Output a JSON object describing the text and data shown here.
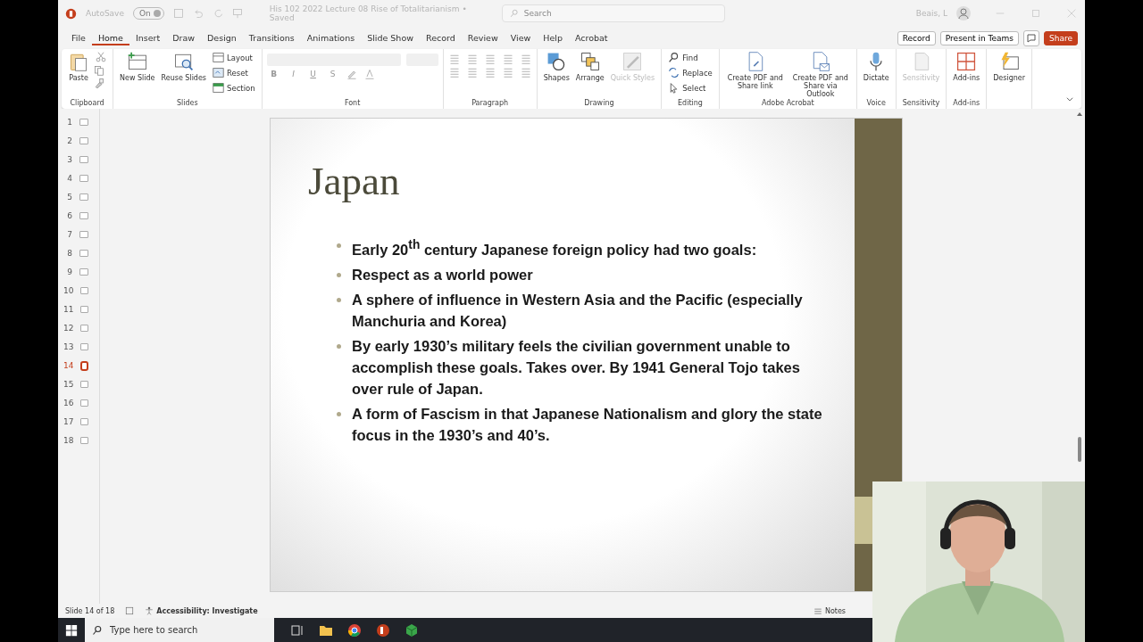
{
  "title_bar": {
    "autosave": {
      "label": "AutoSave",
      "on": true,
      "state_text": "On"
    },
    "document_title": "His 102 2022 Lecture 08 Rise of Totalitarianism • Saved",
    "search": {
      "placeholder": "Search"
    },
    "user": "Beais, L"
  },
  "menu": [
    {
      "label": "File",
      "selected": false
    },
    {
      "label": "Home",
      "selected": true
    },
    {
      "label": "Insert",
      "selected": false
    },
    {
      "label": "Draw",
      "selected": false
    },
    {
      "label": "Design",
      "selected": false
    },
    {
      "label": "Transitions",
      "selected": false
    },
    {
      "label": "Animations",
      "selected": false
    },
    {
      "label": "Slide Show",
      "selected": false
    },
    {
      "label": "Record",
      "selected": false
    },
    {
      "label": "Review",
      "selected": false
    },
    {
      "label": "View",
      "selected": false
    },
    {
      "label": "Help",
      "selected": false
    },
    {
      "label": "Acrobat",
      "selected": false
    }
  ],
  "actions": [
    {
      "label": "Record",
      "kind": "outline"
    },
    {
      "label": "Present in Teams",
      "kind": "outline"
    },
    {
      "label": "Share",
      "kind": "primary"
    }
  ],
  "ribbon": {
    "groups": [
      {
        "name": "Clipboard",
        "kind": "buttons",
        "items": [
          {
            "label": "Paste",
            "kind": "large",
            "disabled": false
          }
        ]
      },
      {
        "name": "Slides",
        "kind": "buttons",
        "items": [
          {
            "label": "New Slide",
            "kind": "large",
            "disabled": false
          },
          {
            "label": "Reuse Slides",
            "kind": "large",
            "disabled": false
          },
          {
            "label": "Layout",
            "kind": "small",
            "disabled": false
          },
          {
            "label": "Reset",
            "kind": "small",
            "disabled": false
          },
          {
            "label": "Section",
            "kind": "small",
            "disabled": false
          }
        ]
      },
      {
        "name": "Font",
        "kind": "font",
        "format_buttons": [
          "B",
          "I",
          "U",
          "S"
        ]
      },
      {
        "name": "Paragraph",
        "kind": "paragraph"
      },
      {
        "name": "Drawing",
        "kind": "buttons",
        "items": [
          {
            "label": "Shapes",
            "kind": "large",
            "disabled": false
          },
          {
            "label": "Arrange",
            "kind": "large",
            "disabled": false
          },
          {
            "label": "Quick Styles",
            "kind": "large",
            "disabled": true
          }
        ]
      },
      {
        "name": "Editing",
        "kind": "buttons",
        "items": [
          {
            "label": "Find",
            "kind": "small",
            "disabled": false
          },
          {
            "label": "Replace",
            "kind": "small",
            "disabled": false
          },
          {
            "label": "Select",
            "kind": "small",
            "disabled": false
          }
        ]
      },
      {
        "name": "Adobe Acrobat",
        "kind": "buttons",
        "items": [
          {
            "label": "Create PDF and Share link",
            "kind": "large",
            "disabled": false
          },
          {
            "label": "Create PDF and Share via Outlook",
            "kind": "large",
            "disabled": false
          }
        ]
      },
      {
        "name": "Voice",
        "kind": "buttons",
        "items": [
          {
            "label": "Dictate",
            "kind": "large",
            "disabled": false
          }
        ]
      },
      {
        "name": "Sensitivity",
        "kind": "buttons",
        "items": [
          {
            "label": "Sensitivity",
            "kind": "large",
            "disabled": true
          }
        ]
      },
      {
        "name": "Add-ins",
        "kind": "buttons",
        "items": [
          {
            "label": "Add-ins",
            "kind": "large",
            "disabled": false
          }
        ]
      },
      {
        "kind": "buttons",
        "items": [
          {
            "label": "Designer",
            "kind": "large",
            "disabled": false
          }
        ]
      }
    ]
  },
  "slide_panel": {
    "slides": [
      {
        "number": "1",
        "selected": false
      },
      {
        "number": "2",
        "selected": false
      },
      {
        "number": "3",
        "selected": false
      },
      {
        "number": "4",
        "selected": false
      },
      {
        "number": "5",
        "selected": false
      },
      {
        "number": "6",
        "selected": false
      },
      {
        "number": "7",
        "selected": false
      },
      {
        "number": "8",
        "selected": false
      },
      {
        "number": "9",
        "selected": false
      },
      {
        "number": "10",
        "selected": false
      },
      {
        "number": "11",
        "selected": false
      },
      {
        "number": "12",
        "selected": false
      },
      {
        "number": "13",
        "selected": false
      },
      {
        "number": "14",
        "selected": true
      },
      {
        "number": "15",
        "selected": false
      },
      {
        "number": "16",
        "selected": false
      },
      {
        "number": "17",
        "selected": false
      },
      {
        "number": "18",
        "selected": false
      }
    ]
  },
  "slide": {
    "title": "Japan",
    "bullets": [
      "Early 20$^{th}$ century Japanese foreign policy had two goals:",
      "Respect as a world power",
      "A sphere of influence in Western Asia and the Pacific (especially Manchuria and Korea)",
      "By early 1930’s military feels the civilian government unable to accomplish these goals. Takes over. By 1941 General Tojo takes over rule of Japan.",
      "A form of Fascism in that Japanese Nationalism and glory the state focus in the 1930’s and 40’s."
    ]
  },
  "status_bar": {
    "slide_position": "Slide 14 of 18",
    "accessibility": "Accessibility: Investigate",
    "notes": "Notes"
  },
  "taskbar": {
    "search": {
      "placeholder": "Type here to search"
    }
  }
}
